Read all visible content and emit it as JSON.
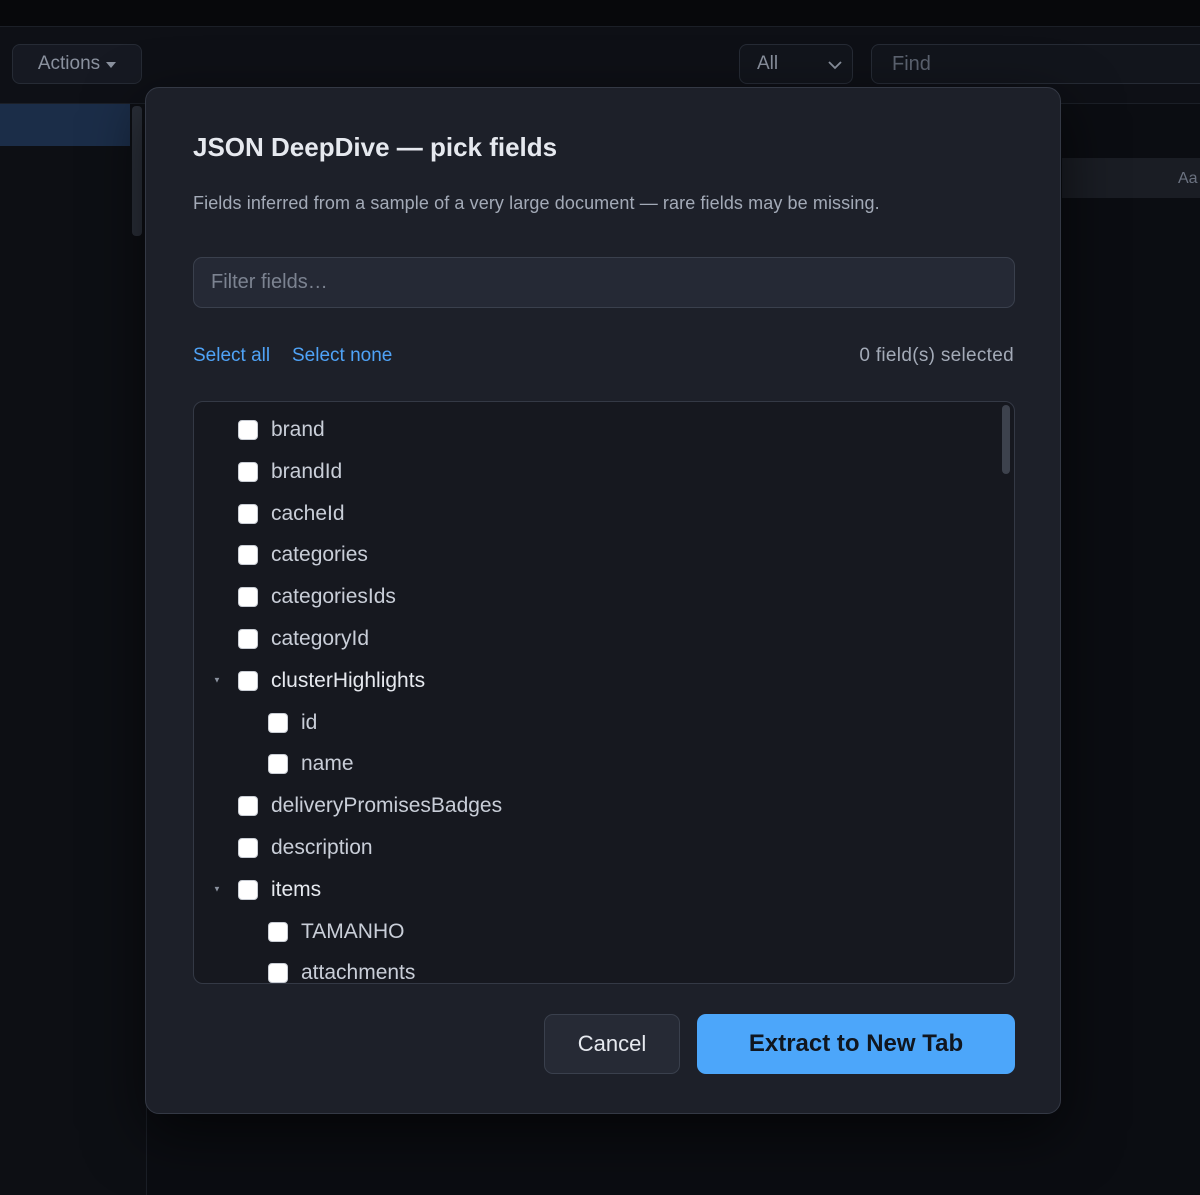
{
  "background": {
    "actions_label": "Actions",
    "scope_value": "All",
    "find_placeholder": "Find",
    "case_toggle": "Aa"
  },
  "modal": {
    "title": "JSON DeepDive — pick fields",
    "subtitle": "Fields inferred from a sample of a very large document — rare fields may be missing.",
    "filter_placeholder": "Filter fields…",
    "select_all": "Select all",
    "select_none": "Select none",
    "selected_count": "0 field(s) selected",
    "fields": [
      {
        "label": "brand",
        "depth": 0,
        "expandable": false,
        "checked": false
      },
      {
        "label": "brandId",
        "depth": 0,
        "expandable": false,
        "checked": false
      },
      {
        "label": "cacheId",
        "depth": 0,
        "expandable": false,
        "checked": false
      },
      {
        "label": "categories",
        "depth": 0,
        "expandable": false,
        "checked": false
      },
      {
        "label": "categoriesIds",
        "depth": 0,
        "expandable": false,
        "checked": false
      },
      {
        "label": "categoryId",
        "depth": 0,
        "expandable": false,
        "checked": false
      },
      {
        "label": "clusterHighlights",
        "depth": 0,
        "expandable": true,
        "checked": false
      },
      {
        "label": "id",
        "depth": 1,
        "expandable": false,
        "checked": false
      },
      {
        "label": "name",
        "depth": 1,
        "expandable": false,
        "checked": false
      },
      {
        "label": "deliveryPromisesBadges",
        "depth": 0,
        "expandable": false,
        "checked": false
      },
      {
        "label": "description",
        "depth": 0,
        "expandable": false,
        "checked": false
      },
      {
        "label": "items",
        "depth": 0,
        "expandable": true,
        "checked": false
      },
      {
        "label": "TAMANHO",
        "depth": 1,
        "expandable": false,
        "checked": false
      },
      {
        "label": "attachments",
        "depth": 1,
        "expandable": false,
        "checked": false
      }
    ],
    "cancel_label": "Cancel",
    "extract_label": "Extract to New Tab"
  }
}
